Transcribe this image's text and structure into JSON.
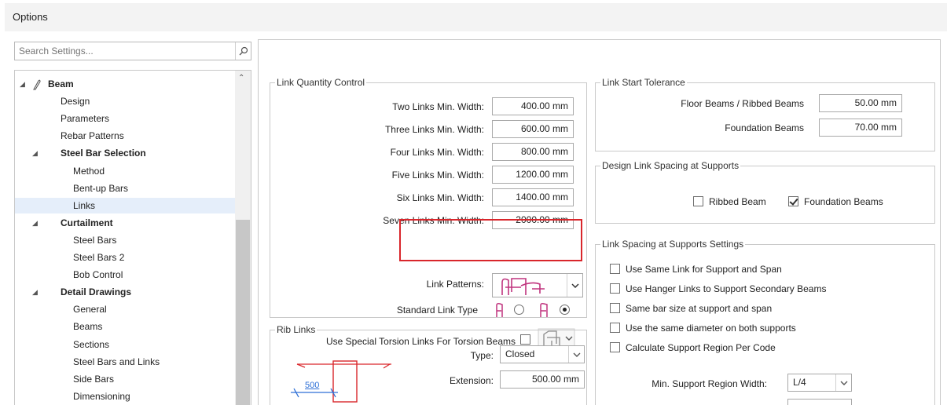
{
  "window": {
    "title": "Options"
  },
  "search": {
    "placeholder": "Search Settings..."
  },
  "tree": [
    {
      "label": "Beam",
      "bold": true,
      "arrow": true,
      "icon": true,
      "selected": false
    },
    {
      "label": "Design",
      "bold": false,
      "arrow": false,
      "selected": false
    },
    {
      "label": "Parameters",
      "bold": false,
      "arrow": false,
      "selected": false
    },
    {
      "label": "Rebar Patterns",
      "bold": false,
      "arrow": false,
      "selected": false
    },
    {
      "label": "Steel Bar Selection",
      "bold": true,
      "arrow": true,
      "selected": false
    },
    {
      "label": "Method",
      "bold": false,
      "arrow": false,
      "selected": false
    },
    {
      "label": "Bent-up Bars",
      "bold": false,
      "arrow": false,
      "selected": false
    },
    {
      "label": "Links",
      "bold": false,
      "arrow": false,
      "selected": true
    },
    {
      "label": "Curtailment",
      "bold": true,
      "arrow": true,
      "selected": false
    },
    {
      "label": "Steel Bars",
      "bold": false,
      "arrow": false,
      "selected": false
    },
    {
      "label": "Steel Bars 2",
      "bold": false,
      "arrow": false,
      "selected": false
    },
    {
      "label": "Bob Control",
      "bold": false,
      "arrow": false,
      "selected": false
    },
    {
      "label": "Detail Drawings",
      "bold": true,
      "arrow": true,
      "selected": false
    },
    {
      "label": "General",
      "bold": false,
      "arrow": false,
      "selected": false
    },
    {
      "label": "Beams",
      "bold": false,
      "arrow": false,
      "selected": false
    },
    {
      "label": "Sections",
      "bold": false,
      "arrow": false,
      "selected": false
    },
    {
      "label": "Steel Bars and Links",
      "bold": false,
      "arrow": false,
      "selected": false
    },
    {
      "label": "Side Bars",
      "bold": false,
      "arrow": false,
      "selected": false
    },
    {
      "label": "Dimensioning",
      "bold": false,
      "arrow": false,
      "selected": false
    }
  ],
  "link_quantity": {
    "title": "Link Quantity Control",
    "rows": [
      {
        "label": "Two Links Min. Width:",
        "value": "400.00 mm"
      },
      {
        "label": "Three Links Min. Width:",
        "value": "600.00 mm"
      },
      {
        "label": "Four Links Min. Width:",
        "value": "800.00 mm"
      },
      {
        "label": "Five Links Min. Width:",
        "value": "1200.00 mm"
      },
      {
        "label": "Six Links Min. Width:",
        "value": "1400.00 mm"
      },
      {
        "label": "Seven Links Min. Width:",
        "value": "2000.00 mm"
      }
    ],
    "patterns_label": "Link Patterns:",
    "standard_label": "Standard Link Type",
    "standard_selected": 1,
    "torsion_label": "Use Special Torsion Links For Torsion Beams",
    "torsion_checked": false
  },
  "rib_links": {
    "title": "Rib Links",
    "type_label": "Type:",
    "type_value": "Closed",
    "extension_label": "Extension:",
    "extension_value": "500.00 mm",
    "dim_value": "500"
  },
  "link_start": {
    "title": "Link Start Tolerance",
    "rows": [
      {
        "label": "Floor Beams / Ribbed Beams",
        "value": "50.00 mm"
      },
      {
        "label": "Foundation Beams",
        "value": "70.00 mm"
      }
    ]
  },
  "design_spacing": {
    "title": "Design Link Spacing at Supports",
    "ribbed_label": "Ribbed Beam",
    "ribbed_checked": false,
    "foundation_label": "Foundation Beams",
    "foundation_checked": true
  },
  "spacing_settings": {
    "title": "Link Spacing at Supports Settings",
    "options": [
      {
        "label": "Use Same Link for Support and Span",
        "checked": false
      },
      {
        "label": "Use Hanger Links to Support Secondary Beams",
        "checked": false
      },
      {
        "label": "Same bar size at support and span",
        "checked": false
      },
      {
        "label": "Use the same diameter on both supports",
        "checked": false
      },
      {
        "label": "Calculate Support Region Per Code",
        "checked": false
      }
    ],
    "min_region_label": "Min. Support Region Width:",
    "min_region_value": "L/4"
  },
  "colors": {
    "accent_red": "#d9262b",
    "link_magenta": "#c0347e",
    "selection": "#e5eefa"
  }
}
